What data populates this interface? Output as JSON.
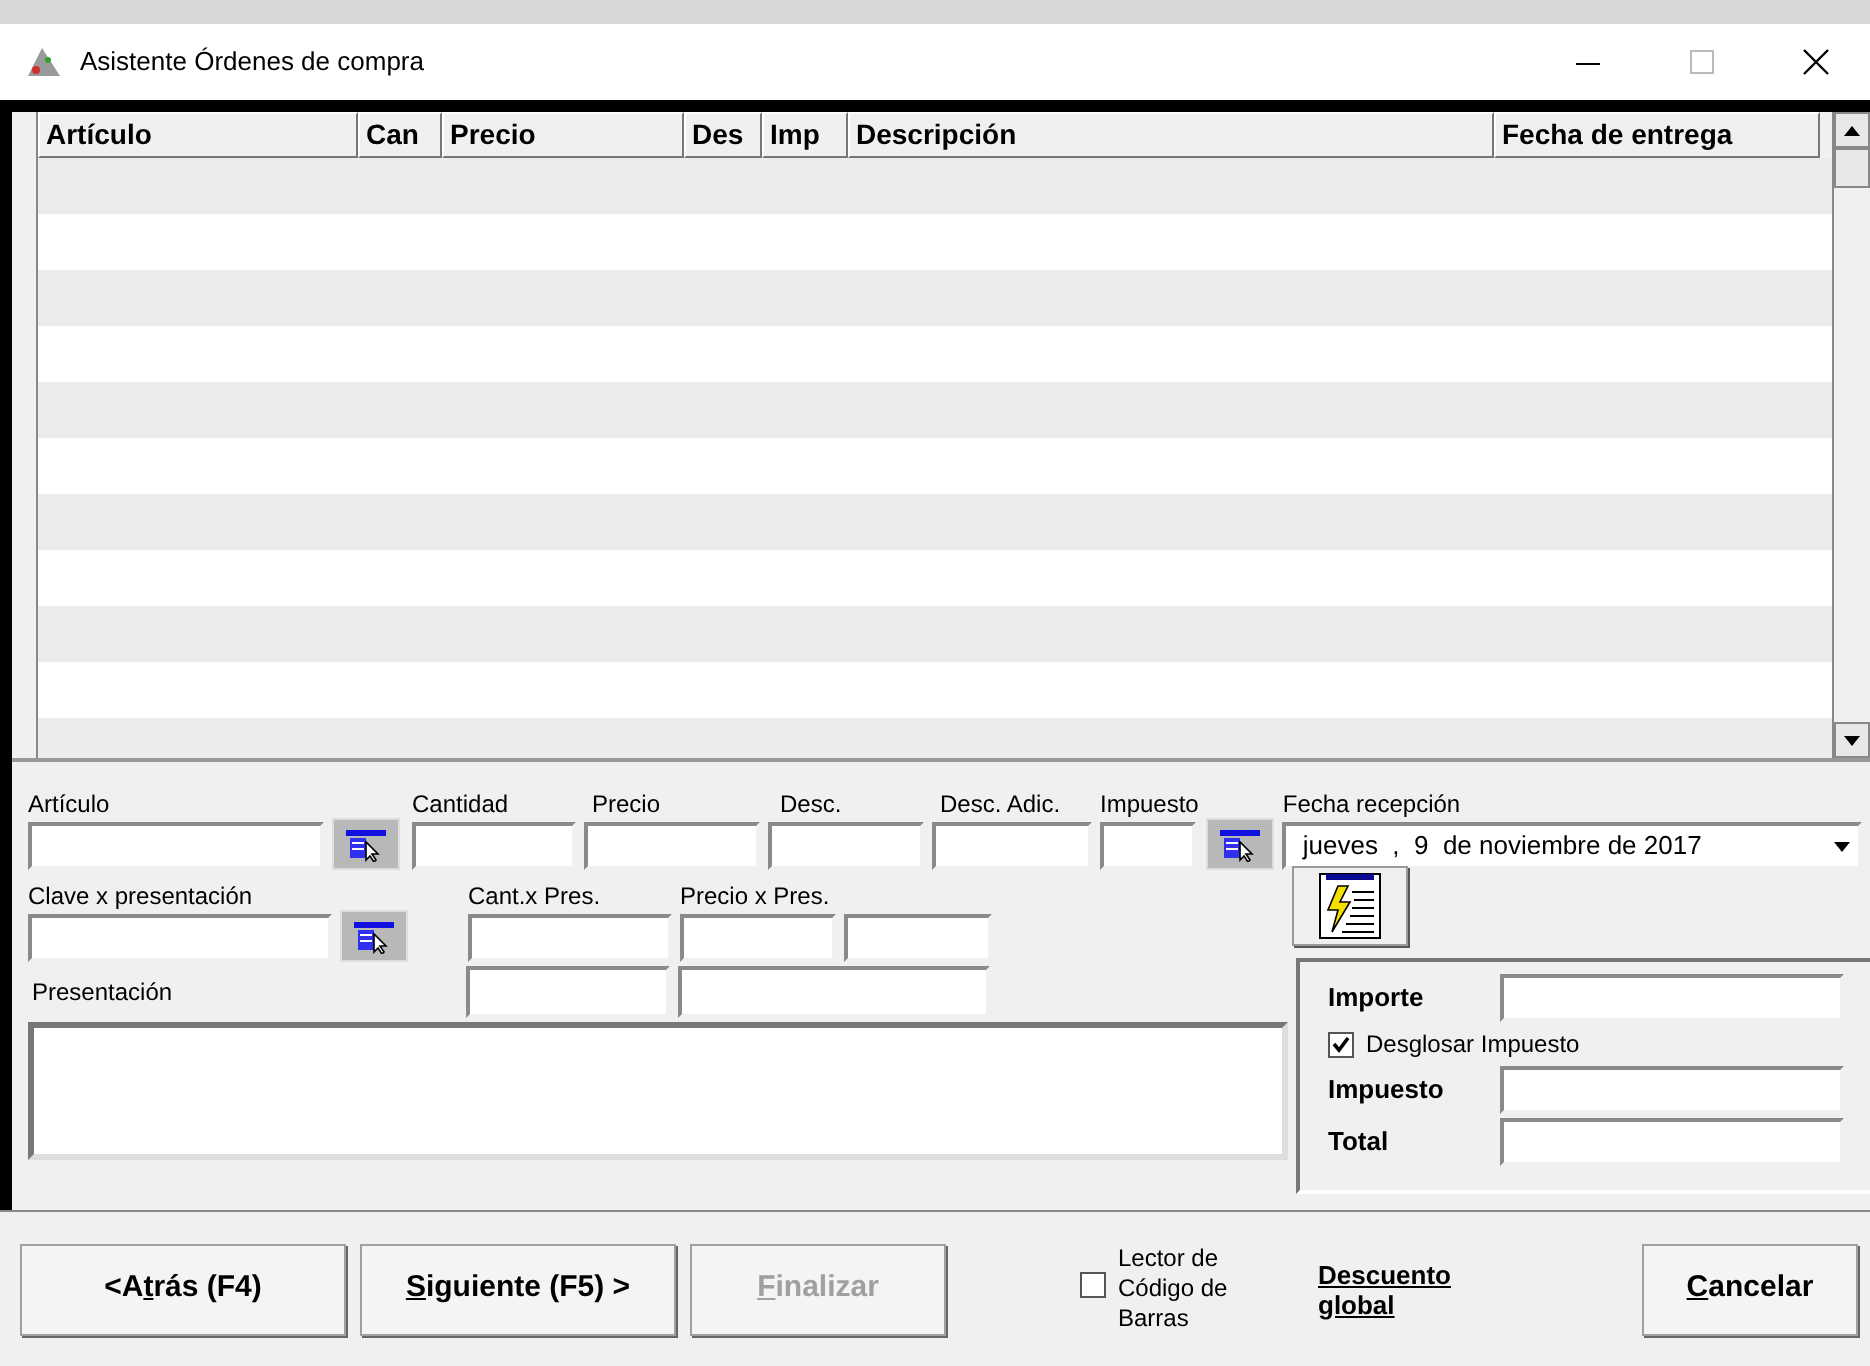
{
  "window": {
    "title": "Asistente Órdenes de compra"
  },
  "table": {
    "columns": [
      "Artículo",
      "Can",
      "Precio",
      "Des",
      "Imp",
      "Descripción",
      "Fecha de entrega"
    ]
  },
  "form": {
    "articulo": {
      "label": "Artículo"
    },
    "cantidad": {
      "label": "Cantidad"
    },
    "precio": {
      "label": "Precio"
    },
    "desc": {
      "label": "Desc."
    },
    "desc_adic": {
      "label": "Desc. Adic."
    },
    "impuesto": {
      "label": "Impuesto"
    },
    "fecha_recepcion": {
      "label": "Fecha recepción",
      "value": "jueves  ,  9  de noviembre de 2017"
    },
    "clave": {
      "label": "Clave x presentación"
    },
    "cant_pres": {
      "label": "Cant.x Pres."
    },
    "precio_pres": {
      "label": "Precio x Pres."
    },
    "presentacion": {
      "label": "Presentación"
    }
  },
  "totals": {
    "importe": {
      "label": "Importe"
    },
    "desglosar": {
      "label": "Desglosar Impuesto",
      "checked": true
    },
    "impuesto": {
      "label": "Impuesto"
    },
    "total": {
      "label": "Total"
    }
  },
  "buttons": [
    {
      "pre": "<A",
      "key": "t",
      "post": "rás (F4)",
      "disabled": false
    },
    {
      "key": "S",
      "post": "iguiente (F5) >",
      "disabled": false
    },
    {
      "key": "F",
      "post": "inalizar",
      "disabled": true
    }
  ],
  "barcode": {
    "label": "Lector de Código de Barras",
    "checked": false
  },
  "discount_link": "Descuento global",
  "cancel": {
    "key": "C",
    "post": "ancelar",
    "disabled": false
  }
}
